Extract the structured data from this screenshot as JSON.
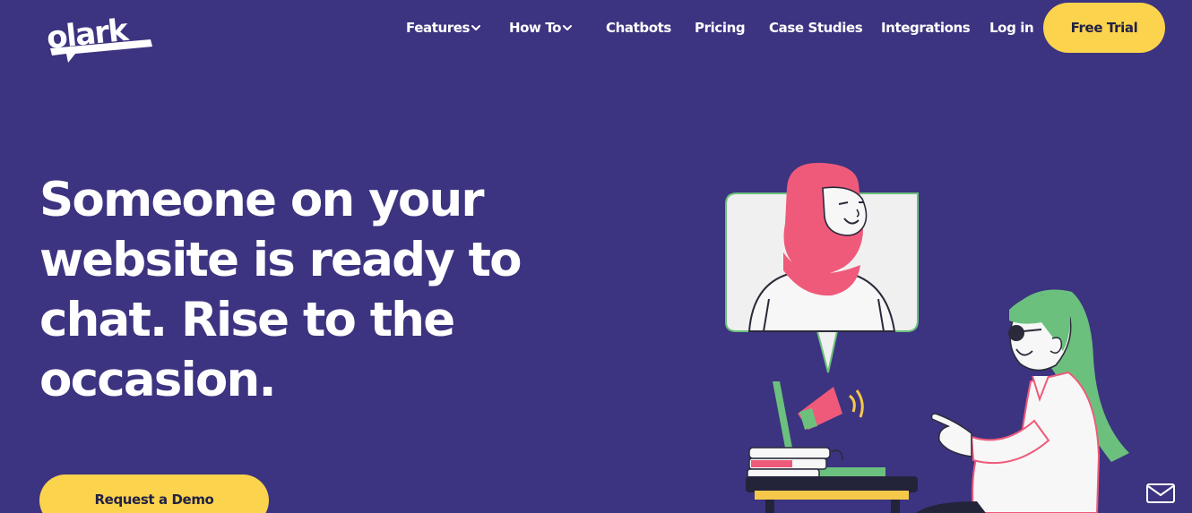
{
  "brand": {
    "logo_text": "olark"
  },
  "nav": {
    "items": [
      {
        "label": "Features",
        "has_dropdown": true
      },
      {
        "label": "How To",
        "has_dropdown": true
      },
      {
        "label": "Chatbots",
        "has_dropdown": false
      },
      {
        "label": "Pricing",
        "has_dropdown": false
      },
      {
        "label": "Case Studies",
        "has_dropdown": false
      },
      {
        "label": "Integrations",
        "has_dropdown": false
      },
      {
        "label": "Log in",
        "has_dropdown": false
      }
    ],
    "cta_label": "Free Trial"
  },
  "hero": {
    "headline": "Someone on your website is ready to chat. Rise to the occasion.",
    "cta_label": "Request a Demo"
  },
  "colors": {
    "background": "#3c3480",
    "accent_yellow": "#fcd34d",
    "illustration_pink": "#ef5a7a",
    "illustration_green": "#6cc07d"
  },
  "icons": {
    "dropdown": "chevron-down-icon",
    "chat_widget": "mail-icon"
  }
}
